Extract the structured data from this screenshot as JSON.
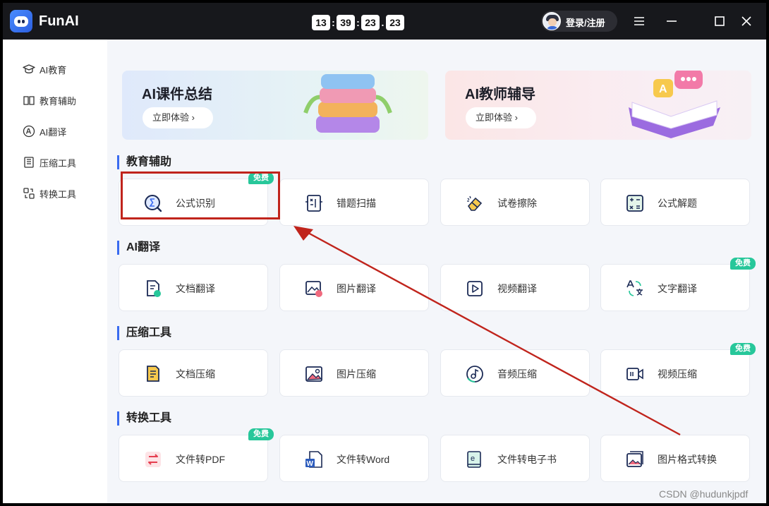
{
  "app": {
    "name": "FunAI"
  },
  "clock": {
    "h": "13",
    "m": "39",
    "s": "23",
    "ms": "23"
  },
  "header": {
    "login_label": "登录/注册"
  },
  "sidebar": {
    "items": [
      {
        "label": "AI教育",
        "icon": "graduation-cap-icon"
      },
      {
        "label": "教育辅助",
        "icon": "book-icon"
      },
      {
        "label": "AI翻译",
        "icon": "translate-icon"
      },
      {
        "label": "压缩工具",
        "icon": "compress-icon"
      },
      {
        "label": "转换工具",
        "icon": "convert-icon"
      }
    ]
  },
  "banners": [
    {
      "title": "AI课件总结",
      "button": "立即体验"
    },
    {
      "title": "AI教师辅导",
      "button": "立即体验"
    }
  ],
  "badge_free": "免费",
  "sections": [
    {
      "title": "教育辅助",
      "cards": [
        {
          "label": "公式识别",
          "icon": "formula-icon",
          "free": true
        },
        {
          "label": "错题扫描",
          "icon": "scan-icon",
          "free": false
        },
        {
          "label": "试卷擦除",
          "icon": "eraser-icon",
          "free": false
        },
        {
          "label": "公式解题",
          "icon": "calculator-icon",
          "free": false
        }
      ]
    },
    {
      "title": "AI翻译",
      "cards": [
        {
          "label": "文档翻译",
          "icon": "doc-translate-icon",
          "free": false
        },
        {
          "label": "图片翻译",
          "icon": "image-translate-icon",
          "free": false
        },
        {
          "label": "视频翻译",
          "icon": "video-translate-icon",
          "free": false
        },
        {
          "label": "文字翻译",
          "icon": "text-translate-icon",
          "free": true
        }
      ]
    },
    {
      "title": "压缩工具",
      "cards": [
        {
          "label": "文档压缩",
          "icon": "doc-compress-icon",
          "free": false
        },
        {
          "label": "图片压缩",
          "icon": "image-compress-icon",
          "free": false
        },
        {
          "label": "音频压缩",
          "icon": "audio-compress-icon",
          "free": false
        },
        {
          "label": "视频压缩",
          "icon": "video-compress-icon",
          "free": true
        }
      ]
    },
    {
      "title": "转换工具",
      "cards": [
        {
          "label": "文件转PDF",
          "icon": "pdf-convert-icon",
          "free": true
        },
        {
          "label": "文件转Word",
          "icon": "word-convert-icon",
          "free": false
        },
        {
          "label": "文件转电子书",
          "icon": "ebook-convert-icon",
          "free": false
        },
        {
          "label": "图片格式转换",
          "icon": "image-format-icon",
          "free": false
        }
      ]
    }
  ],
  "watermark": "CSDN @hudunkjpdf",
  "colors": {
    "accent": "#3a6bf0",
    "badge": "#27c79a",
    "annotation": "#c0241c",
    "titlebar": "#17181c"
  }
}
